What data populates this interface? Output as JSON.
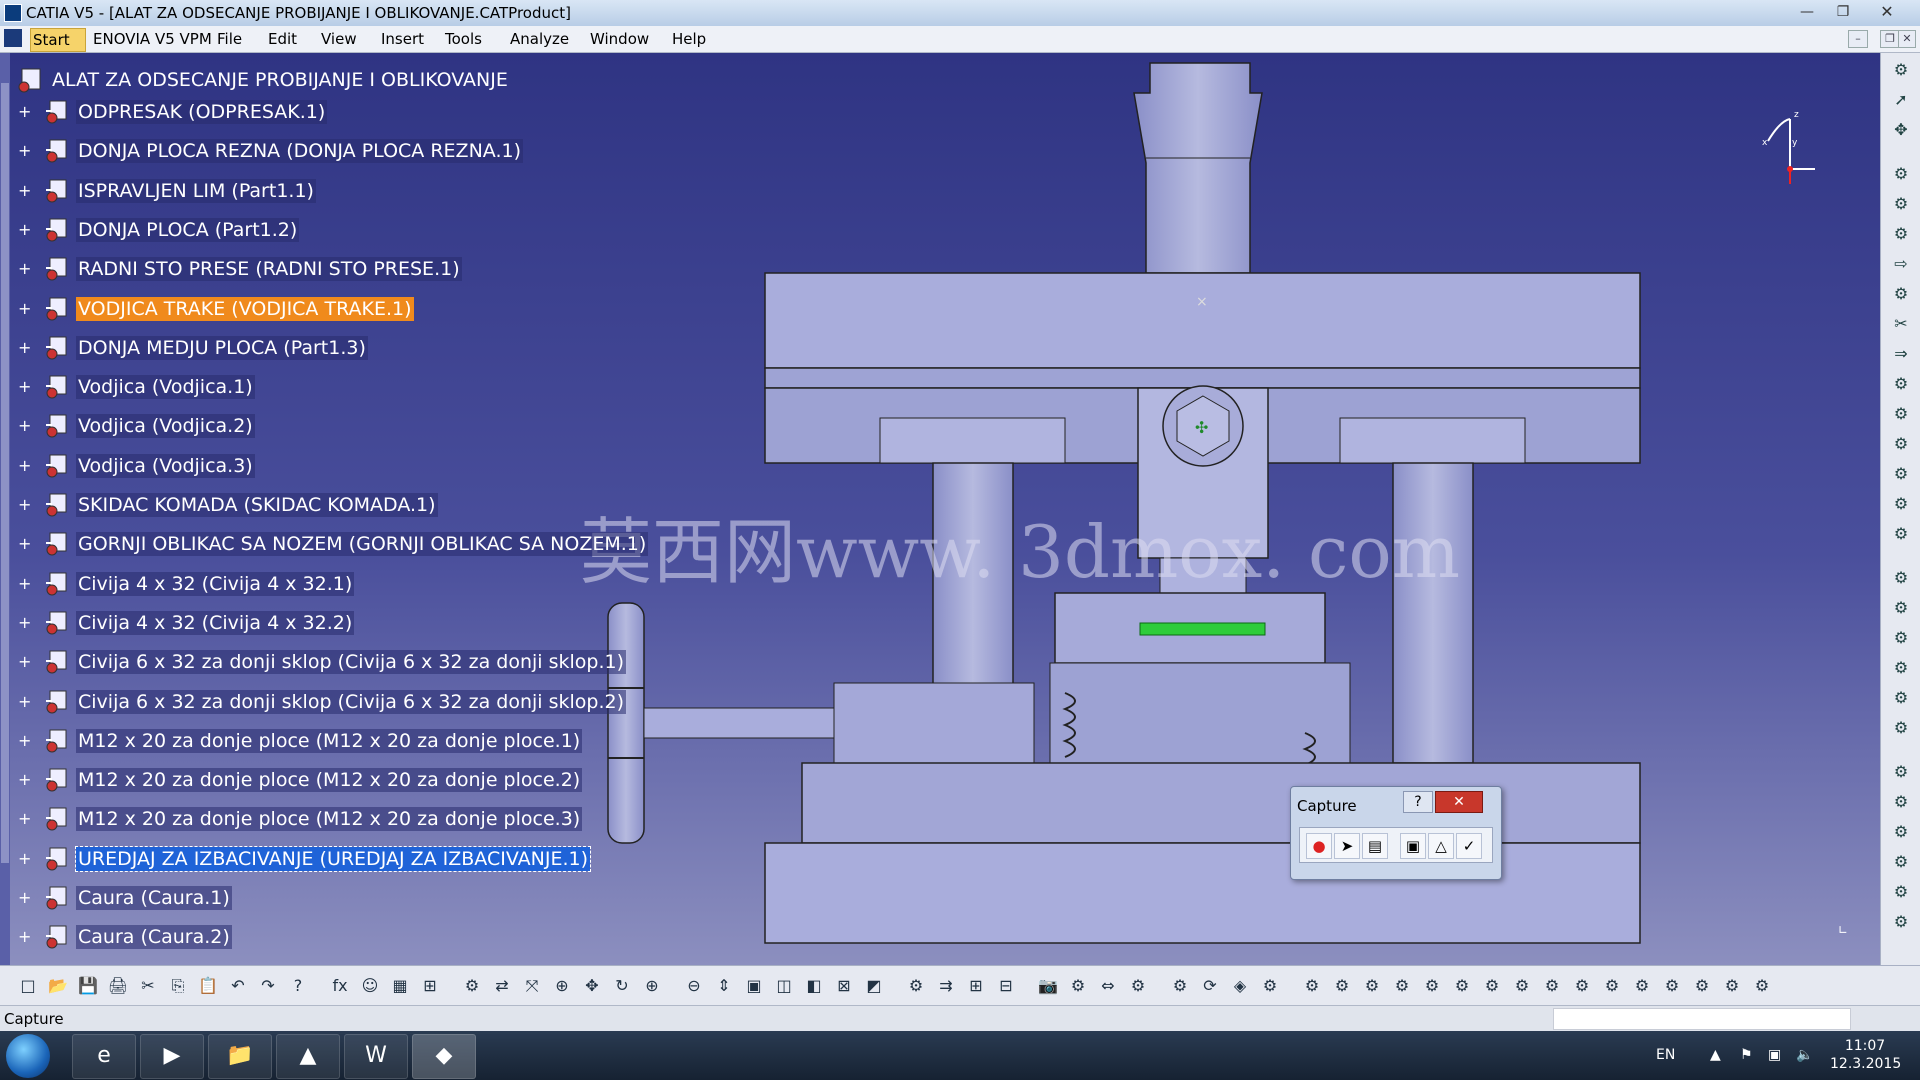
{
  "window": {
    "title": "CATIA V5 - [ALAT ZA ODSECANJE PROBIJANJE I OBLIKOVANJE.CATProduct]"
  },
  "menu": {
    "start": "Start",
    "items": [
      "ENOVIA V5 VPM",
      "File",
      "Edit",
      "View",
      "Insert",
      "Tools",
      "Analyze",
      "Window",
      "Help"
    ]
  },
  "tree": {
    "root": "ALAT ZA ODSECANJE PROBIJANJE I OBLIKOVANJE",
    "items": [
      {
        "label": "ODPRESAK (ODPRESAK.1)",
        "state": ""
      },
      {
        "label": "DONJA PLOCA REZNA (DONJA PLOCA REZNA.1)",
        "state": ""
      },
      {
        "label": "ISPRAVLJEN LIM (Part1.1)",
        "state": ""
      },
      {
        "label": "DONJA PLOCA (Part1.2)",
        "state": ""
      },
      {
        "label": "RADNI STO PRESE (RADNI STO PRESE.1)",
        "state": ""
      },
      {
        "label": "VODJICA TRAKE (VODJICA TRAKE.1)",
        "state": "orange"
      },
      {
        "label": "DONJA MEDJU PLOCA (Part1.3)",
        "state": ""
      },
      {
        "label": "Vodjica (Vodjica.1)",
        "state": ""
      },
      {
        "label": "Vodjica (Vodjica.2)",
        "state": ""
      },
      {
        "label": "Vodjica (Vodjica.3)",
        "state": ""
      },
      {
        "label": "SKIDAC KOMADA (SKIDAC KOMADA.1)",
        "state": ""
      },
      {
        "label": "GORNJI OBLIKAC SA NOZEM (GORNJI OBLIKAC SA NOZEM.1)",
        "state": ""
      },
      {
        "label": "Civija 4 x 32 (Civija 4 x 32.1)",
        "state": ""
      },
      {
        "label": "Civija 4 x 32 (Civija 4 x 32.2)",
        "state": ""
      },
      {
        "label": "Civija 6 x 32 za donji sklop (Civija 6 x 32 za donji sklop.1)",
        "state": ""
      },
      {
        "label": "Civija 6 x 32 za donji sklop (Civija 6 x 32 za donji sklop.2)",
        "state": ""
      },
      {
        "label": "M12 x 20 za donje ploce (M12 x 20 za donje ploce.1)",
        "state": ""
      },
      {
        "label": "M12 x 20 za donje ploce (M12 x 20 za donje ploce.2)",
        "state": ""
      },
      {
        "label": "M12 x 20 za donje ploce (M12 x 20 za donje ploce.3)",
        "state": ""
      },
      {
        "label": "UREDJAJ ZA IZBACIVANJE (UREDJAJ ZA IZBACIVANJE.1)",
        "state": "blue"
      },
      {
        "label": "Caura (Caura.1)",
        "state": ""
      },
      {
        "label": "Caura (Caura.2)",
        "state": ""
      }
    ]
  },
  "watermark": "莫西网www. 3dmox. com",
  "compass": {
    "x": "x",
    "y": "y",
    "z": "z"
  },
  "capture_dialog": {
    "title": "Capture",
    "help": "?",
    "close": "✕"
  },
  "status": {
    "text": "Capture"
  },
  "taskbar": {
    "lang": "EN",
    "time": "11:07",
    "date": "12.3.2015"
  },
  "colors": {
    "selection_orange": "#f08a1c",
    "selection_blue": "#1f63d8",
    "viewport": "#3a3f8f"
  }
}
